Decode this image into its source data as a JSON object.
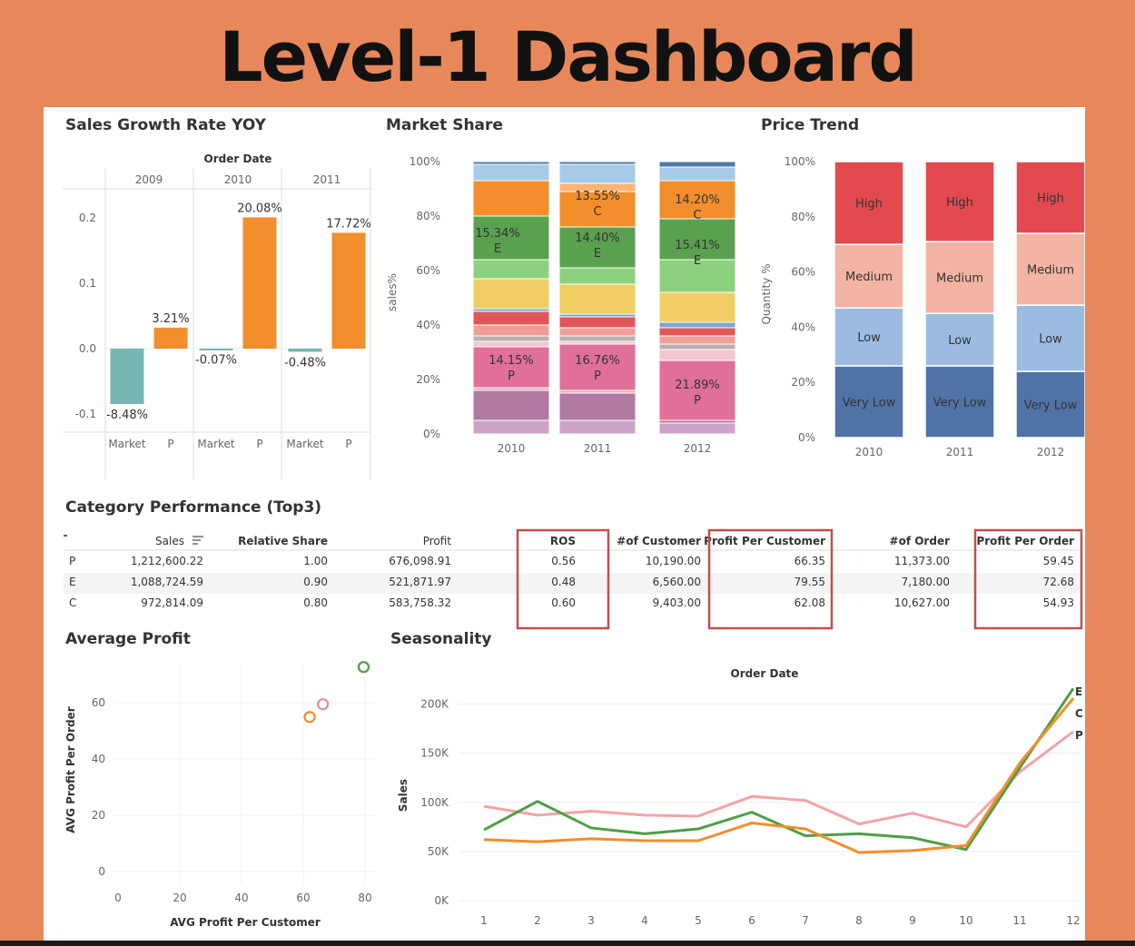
{
  "title": "Level-1 Dashboard",
  "colors": {
    "background": "#E8885A",
    "P": "#E8899A",
    "E": "#4E9E46",
    "C": "#F28E2B",
    "market": "#76B7B2",
    "high": "#E34A4F",
    "medium": "#F4B4A3",
    "low": "#9CBBE0",
    "verylow": "#4F73A6",
    "highlight": "#C0504D"
  },
  "growth": {
    "title": "Sales Growth Rate  YOY",
    "header": "Order Date",
    "years": [
      "2009",
      "2010",
      "2011"
    ],
    "yticks": [
      "0.2",
      "0.1",
      "0.0",
      "-0.1"
    ],
    "xlabels": [
      "Market",
      "P",
      "Market",
      "P",
      "Market",
      "P"
    ]
  },
  "share": {
    "title": "Market Share",
    "ylabel": "sales%",
    "yticks": [
      "100%",
      "80%",
      "60%",
      "40%",
      "20%",
      "0%"
    ]
  },
  "price": {
    "title": "Price Trend",
    "ylabel": "Quantity %",
    "yticks": [
      "100%",
      "80%",
      "60%",
      "40%",
      "20%",
      "0%"
    ]
  },
  "table": {
    "title": "Category Performance (Top3)",
    "sort_icon": "sort-descending-icon",
    "headers": [
      "Sales",
      "Relative Share",
      "Profit",
      "ROS",
      "#of Customer",
      "Profit Per Customer",
      "#of Order",
      "Profit Per Order"
    ],
    "rows": [
      {
        "cat": "P",
        "cells": [
          "1,212,600.22",
          "1.00",
          "676,098.91",
          "0.56",
          "10,190.00",
          "66.35",
          "11,373.00",
          "59.45"
        ]
      },
      {
        "cat": "E",
        "cells": [
          "1,088,724.59",
          "0.90",
          "521,871.97",
          "0.48",
          "6,560.00",
          "79.55",
          "7,180.00",
          "72.68"
        ]
      },
      {
        "cat": "C",
        "cells": [
          "972,814.09",
          "0.80",
          "583,758.32",
          "0.60",
          "9,403.00",
          "62.08",
          "10,627.00",
          "54.93"
        ]
      }
    ]
  },
  "avg": {
    "title": "Average Profit",
    "xlabel": "AVG Profit Per Customer",
    "ylabel": "AVG Profit Per Order",
    "xticks": [
      "0",
      "20",
      "40",
      "60",
      "80"
    ],
    "yticks": [
      "60",
      "40",
      "20",
      "0"
    ]
  },
  "season": {
    "title": "Seasonality",
    "header": "Order Date",
    "ylabel": "Sales",
    "yticks": [
      "200K",
      "150K",
      "100K",
      "50K",
      "0K"
    ]
  },
  "chart_data": [
    {
      "type": "bar",
      "title": "Sales Growth Rate  YOY",
      "categories": [
        "2009 Market",
        "2009 P",
        "2010 Market",
        "2010 P",
        "2011 Market",
        "2011 P"
      ],
      "values": [
        -0.0848,
        0.0321,
        -0.0007,
        0.2008,
        -0.0048,
        0.1772
      ],
      "data_labels": [
        "-8.48%",
        "3.21%",
        "-0.07%",
        "20.08%",
        "-0.48%",
        "17.72%"
      ],
      "ylim": [
        -0.13,
        0.27
      ]
    },
    {
      "type": "bar",
      "title": "Market Share",
      "ylabel": "sales%",
      "categories": [
        "2010",
        "2011",
        "2012"
      ],
      "stacked": true,
      "segment_colors": [
        "#CFA3C8",
        "#B07AA1",
        "#EBA8B4",
        "#E0709A",
        "#F4C6CF",
        "#BAB0AC",
        "#F29E98",
        "#E15759",
        "#79A8D0",
        "#F1CE63",
        "#8CD17D",
        "#59A14F",
        "#F28E2B",
        "#FFB470",
        "#A6CBE8",
        "#4E79A7"
      ],
      "segments_pct": [
        [
          5,
          11,
          1,
          15,
          2,
          2,
          4,
          5,
          1,
          11,
          7,
          16,
          13,
          0,
          6,
          1
        ],
        [
          5,
          10,
          1,
          17,
          1,
          2,
          3,
          4,
          1,
          11,
          6,
          15,
          13,
          3,
          7,
          1
        ],
        [
          4,
          1,
          0,
          22,
          4,
          2,
          3,
          3,
          2,
          11,
          12,
          15,
          14,
          0,
          5,
          2
        ]
      ],
      "labels": [
        {
          "year": "2010",
          "text": "14.15%",
          "cat": "P"
        },
        {
          "year": "2010",
          "text": "15.34%",
          "cat": "E"
        },
        {
          "year": "2011",
          "text": "16.76%",
          "cat": "P"
        },
        {
          "year": "2011",
          "text": "14.40%",
          "cat": "E"
        },
        {
          "year": "2011",
          "text": "13.55%",
          "cat": "C"
        },
        {
          "year": "2012",
          "text": "21.89%",
          "cat": "P"
        },
        {
          "year": "2012",
          "text": "15.41%",
          "cat": "E"
        },
        {
          "year": "2012",
          "text": "14.20%",
          "cat": "C"
        }
      ],
      "ylim": [
        0,
        100
      ]
    },
    {
      "type": "bar",
      "title": "Price Trend",
      "ylabel": "Quantity %",
      "stacked": true,
      "categories": [
        "2010",
        "2011",
        "2012"
      ],
      "series": [
        {
          "name": "Very Low",
          "values": [
            26,
            26,
            24
          ]
        },
        {
          "name": "Low",
          "values": [
            21,
            19,
            24
          ]
        },
        {
          "name": "Medium",
          "values": [
            23,
            26,
            26
          ]
        },
        {
          "name": "High",
          "values": [
            30,
            29,
            26
          ]
        }
      ],
      "ylim": [
        0,
        100
      ]
    },
    {
      "type": "table",
      "title": "Category Performance (Top3)",
      "columns": [
        "Sales",
        "Relative Share",
        "Profit",
        "ROS",
        "#of Customer",
        "Profit Per Customer",
        "#of Order",
        "Profit Per Order"
      ],
      "rows": [
        [
          "P",
          1212600.22,
          1.0,
          676098.91,
          0.56,
          10190,
          66.35,
          11373,
          59.45
        ],
        [
          "E",
          1088724.59,
          0.9,
          521871.97,
          0.48,
          6560,
          79.55,
          7180,
          72.68
        ],
        [
          "C",
          972814.09,
          0.8,
          583758.32,
          0.6,
          9403,
          62.08,
          10627,
          54.93
        ]
      ]
    },
    {
      "type": "scatter",
      "title": "Average Profit",
      "xlabel": "AVG Profit Per Customer",
      "ylabel": "AVG Profit Per Order",
      "points": [
        {
          "x": 66.35,
          "y": 59.45,
          "color": "#E8899A"
        },
        {
          "x": 79.55,
          "y": 72.68,
          "color": "#4E9E46"
        },
        {
          "x": 62.08,
          "y": 54.93,
          "color": "#F28E2B"
        }
      ],
      "xlim": [
        0,
        85
      ],
      "ylim": [
        0,
        75
      ]
    },
    {
      "type": "line",
      "title": "Seasonality",
      "xlabel": "Order Date",
      "ylabel": "Sales",
      "x": [
        1,
        2,
        3,
        4,
        5,
        6,
        7,
        8,
        9,
        10,
        11,
        12
      ],
      "series": [
        {
          "name": "P",
          "color": "#F4A3A8",
          "values": [
            96000,
            87000,
            91000,
            87000,
            86000,
            106000,
            102000,
            78000,
            89000,
            75000,
            131000,
            172000
          ]
        },
        {
          "name": "E",
          "color": "#4E9E46",
          "values": [
            72000,
            101000,
            74000,
            68000,
            73000,
            90000,
            66000,
            68000,
            64000,
            52000,
            135000,
            216000
          ]
        },
        {
          "name": "C",
          "color": "#F28E2B",
          "values": [
            62000,
            60000,
            63000,
            61000,
            61000,
            79000,
            73000,
            49000,
            51000,
            56000,
            140000,
            206000
          ]
        }
      ],
      "ylim": [
        0,
        220000
      ]
    }
  ]
}
